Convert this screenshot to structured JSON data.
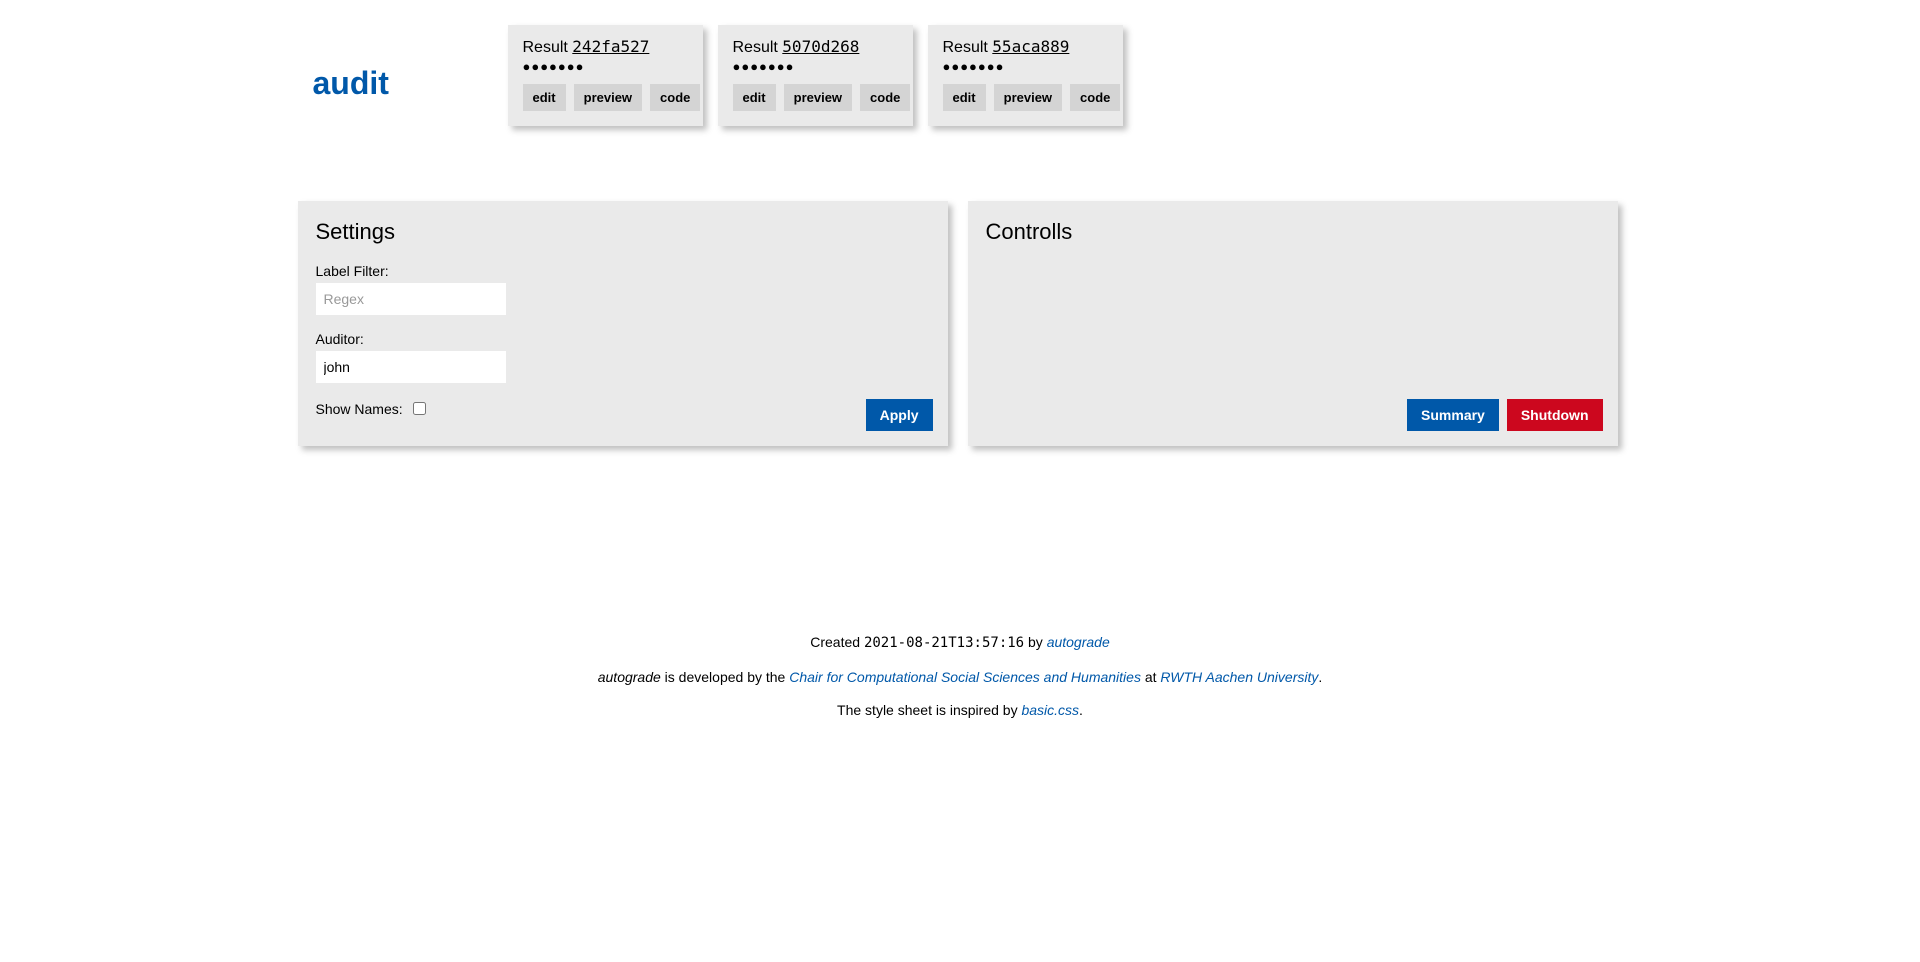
{
  "brand": "audit",
  "results": [
    {
      "prefix": "Result ",
      "hash": "242fa527",
      "dots": "●●●●●●●",
      "edit": "edit",
      "preview": "preview",
      "code": "code"
    },
    {
      "prefix": "Result ",
      "hash": "5070d268",
      "dots": "●●●●●●●",
      "edit": "edit",
      "preview": "preview",
      "code": "code"
    },
    {
      "prefix": "Result ",
      "hash": "55aca889",
      "dots": "●●●●●●●",
      "edit": "edit",
      "preview": "preview",
      "code": "code"
    }
  ],
  "settings": {
    "heading": "Settings",
    "label_filter_label": "Label Filter:",
    "label_filter_placeholder": "Regex",
    "label_filter_value": "",
    "auditor_label": "Auditor:",
    "auditor_value": "john",
    "show_names_label": "Show Names:",
    "show_names_checked": false,
    "apply_label": "Apply"
  },
  "controls": {
    "heading": "Controlls",
    "summary_label": "Summary",
    "shutdown_label": "Shutdown"
  },
  "footer": {
    "created_prefix": "Created ",
    "created_ts": "2021-08-21T13:57:16",
    "created_by": " by ",
    "autograde": "autograde",
    "line2_pre": " is developed by the ",
    "chair": "Chair for Computational Social Sciences and Humanities",
    "at": " at ",
    "uni": "RWTH Aachen University",
    "period": ".",
    "line3_pre": "The style sheet is inspired by ",
    "basic": "basic.css"
  }
}
